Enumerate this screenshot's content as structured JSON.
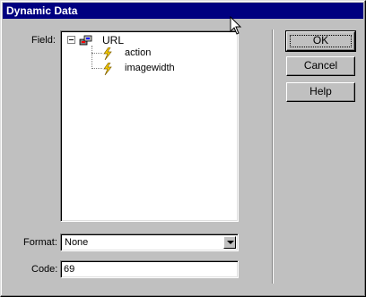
{
  "window": {
    "title": "Dynamic Data"
  },
  "field_label": "Field:",
  "tree": {
    "root": {
      "label": "URL",
      "icon": "database-icon"
    },
    "children": [
      {
        "label": "action",
        "icon": "lightning-bolt-icon"
      },
      {
        "label": "imagewidth",
        "icon": "lightning-bolt-icon"
      }
    ]
  },
  "format": {
    "label": "Format:",
    "value": "None"
  },
  "code": {
    "label": "Code:",
    "value": "69"
  },
  "buttons": {
    "ok": "OK",
    "cancel": "Cancel",
    "help": "Help"
  },
  "colors": {
    "titlebar": "#000080",
    "face": "#c0c0c0",
    "bolt": "#ffd400"
  }
}
